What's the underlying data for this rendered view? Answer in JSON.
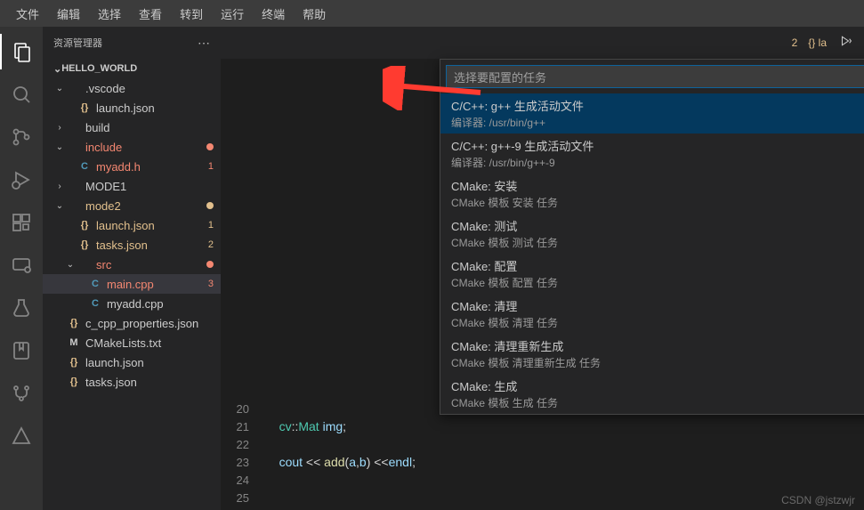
{
  "menubar": [
    "文件",
    "编辑",
    "选择",
    "查看",
    "转到",
    "运行",
    "终端",
    "帮助"
  ],
  "sidebar": {
    "title": "资源管理器",
    "project": "HELLO_WORLD",
    "tree": [
      {
        "type": "folder",
        "label": ".vscode",
        "indent": 1,
        "open": true
      },
      {
        "type": "file",
        "label": "launch.json",
        "indent": 2,
        "icon": "json"
      },
      {
        "type": "folder",
        "label": "build",
        "indent": 1,
        "open": false
      },
      {
        "type": "folder",
        "label": "include",
        "indent": 1,
        "open": true,
        "color": "red",
        "badgeDot": "red"
      },
      {
        "type": "file",
        "label": "myadd.h",
        "indent": 2,
        "icon": "c",
        "color": "red",
        "badge": "1"
      },
      {
        "type": "folder",
        "label": "MODE1",
        "indent": 1,
        "open": false
      },
      {
        "type": "folder",
        "label": "mode2",
        "indent": 1,
        "open": true,
        "color": "orange",
        "badgeDot": "orange"
      },
      {
        "type": "file",
        "label": "launch.json",
        "indent": 2,
        "icon": "json",
        "color": "orange",
        "badge": "1"
      },
      {
        "type": "file",
        "label": "tasks.json",
        "indent": 2,
        "icon": "json",
        "color": "orange",
        "badge": "2"
      },
      {
        "type": "folder",
        "label": "src",
        "indent": 2,
        "open": true,
        "color": "red",
        "badgeDot": "red"
      },
      {
        "type": "file",
        "label": "main.cpp",
        "indent": 3,
        "icon": "c",
        "color": "red",
        "badge": "3",
        "selected": true
      },
      {
        "type": "file",
        "label": "myadd.cpp",
        "indent": 3,
        "icon": "c"
      },
      {
        "type": "file",
        "label": "c_cpp_properties.json",
        "indent": 1,
        "icon": "json"
      },
      {
        "type": "file",
        "label": "CMakeLists.txt",
        "indent": 1,
        "icon": "cmake"
      },
      {
        "type": "file",
        "label": "launch.json",
        "indent": 1,
        "icon": "json"
      },
      {
        "type": "file",
        "label": "tasks.json",
        "indent": 1,
        "icon": "json"
      }
    ]
  },
  "quickpick": {
    "placeholder": "选择要配置的任务",
    "items": [
      {
        "label": "C/C++: g++ 生成活动文件",
        "desc": "编译器: /usr/bin/g++",
        "selected": true
      },
      {
        "label": "C/C++: g++-9 生成活动文件",
        "desc": "编译器: /usr/bin/g++-9"
      },
      {
        "label": "CMake: 安装",
        "desc": "CMake 模板 安装 任务"
      },
      {
        "label": "CMake: 测试",
        "desc": "CMake 模板 测试 任务"
      },
      {
        "label": "CMake: 配置",
        "desc": "CMake 模板 配置 任务"
      },
      {
        "label": "CMake: 清理",
        "desc": "CMake 模板 清理 任务"
      },
      {
        "label": "CMake: 清理重新生成",
        "desc": "CMake 模板 清理重新生成 任务"
      },
      {
        "label": "CMake: 生成",
        "desc": "CMake 模板 生成 任务"
      }
    ]
  },
  "tabbar": {
    "badge": "2",
    "label": "{} la"
  },
  "code": {
    "lines": [
      {
        "num": "20",
        "html": ""
      },
      {
        "num": "21",
        "html": "    <span class='kw'>cv</span><span class='op'>::</span><span class='kw'>Mat</span> <span class='var'>img</span><span class='pn'>;</span>"
      },
      {
        "num": "22",
        "html": ""
      },
      {
        "num": "23",
        "html": "    <span class='var'>cout</span> <span class='op'>&lt;&lt;</span> <span class='fn'>add</span><span class='pn'>(</span><span class='var'>a</span><span class='pn'>,</span><span class='var'>b</span><span class='pn'>)</span> <span class='op'>&lt;&lt;</span><span class='var'>endl</span><span class='pn'>;</span>"
      },
      {
        "num": "24",
        "html": ""
      },
      {
        "num": "25",
        "html": ""
      }
    ]
  },
  "watermark": "CSDN @jstzwjr"
}
